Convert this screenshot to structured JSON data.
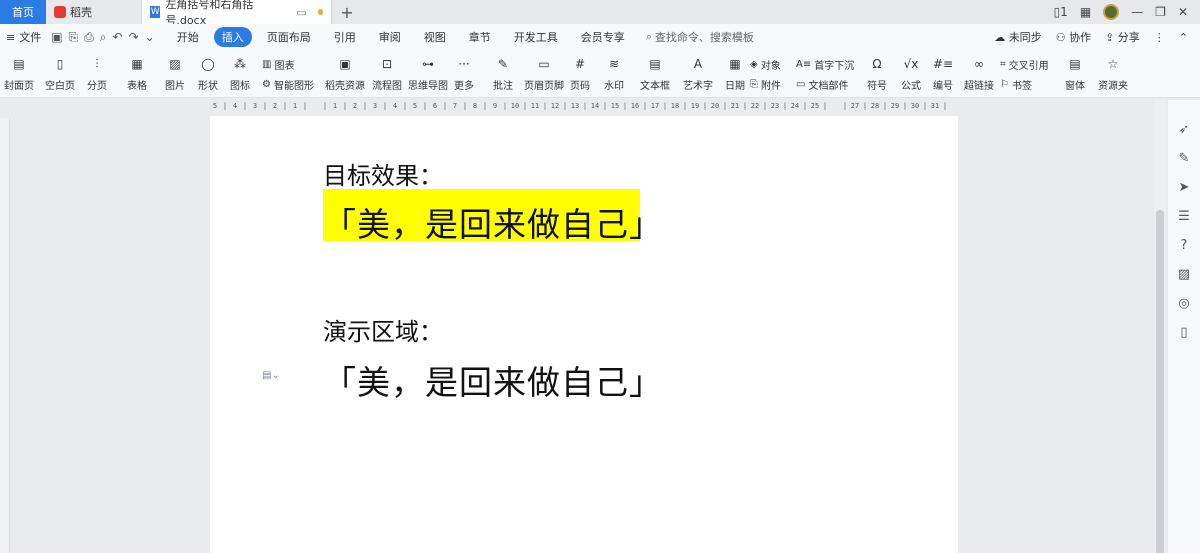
{
  "tabs": {
    "home": "首页",
    "daoke": "稻壳",
    "document": "左角括号和右角括号.docx",
    "new_tab": "+"
  },
  "window": {
    "layout_icon": "▯1",
    "grid_icon": "▦",
    "minimize": "—",
    "restore": "❐",
    "close": "✕"
  },
  "menu": {
    "file": "文件",
    "tabs": [
      "开始",
      "插入",
      "页面布局",
      "引用",
      "审阅",
      "视图",
      "章节",
      "开发工具",
      "会员专享"
    ],
    "active_tab": "插入",
    "search_placeholder": "查找命令、搜索模板",
    "sync": "未同步",
    "collab": "协作",
    "share": "分享"
  },
  "ribbon": {
    "cover": "封面页",
    "blank": "空白页",
    "pagebreak": "分页",
    "table": "表格",
    "picture": "图片",
    "shape": "形状",
    "icon": "图标",
    "chart": "图表",
    "smartart": "智能图形",
    "daoke_res": "稻壳资源",
    "flowchart": "流程图",
    "mindmap": "思维导图",
    "more": "更多",
    "comment": "批注",
    "header_footer": "页眉页脚",
    "page_num": "页码",
    "watermark": "水印",
    "textbox": "文本框",
    "wordart": "艺术字",
    "date": "日期",
    "object": "对象",
    "attachment": "附件",
    "dropcap": "首字下沉",
    "docpart": "文档部件",
    "symbol": "符号",
    "formula": "公式",
    "numbering": "编号",
    "crossref": "交叉引用",
    "hyperlink": "超链接",
    "bookmark": "书签",
    "form": "窗体",
    "resources": "资源夹"
  },
  "ruler": {
    "ticks": [
      "5",
      "4",
      "3",
      "2",
      "1",
      "",
      "1",
      "2",
      "3",
      "4",
      "5",
      "6",
      "7",
      "8",
      "9",
      "10",
      "11",
      "12",
      "13",
      "14",
      "15",
      "16",
      "17",
      "18",
      "19",
      "20",
      "21",
      "22",
      "23",
      "24",
      "25",
      "",
      "27",
      "28",
      "29",
      "30",
      "31"
    ]
  },
  "document": {
    "heading_target": "目标效果：",
    "target_quote": "「美，是回来做自己」",
    "heading_demo": "演示区域：",
    "demo_quote": "「美，是回来做自己」",
    "highlight_color": "#ffff00"
  },
  "colors": {
    "accent": "#2b7be4",
    "unsaved_dot": "#f2a531"
  }
}
